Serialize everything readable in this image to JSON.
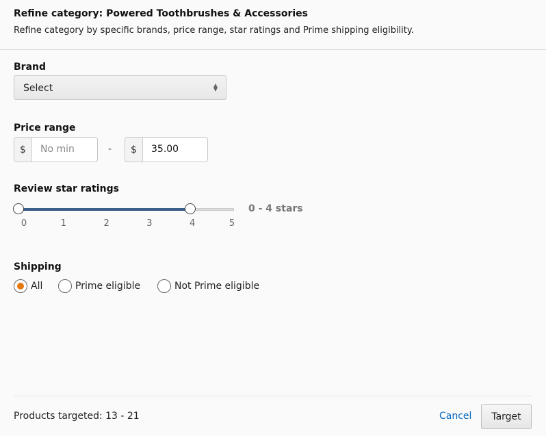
{
  "header": {
    "title": "Refine category: Powered Toothbrushes & Accessories",
    "subtitle": "Refine category by specific brands, price range, star ratings and Prime shipping eligibility."
  },
  "brand": {
    "label": "Brand",
    "selected": "Select"
  },
  "price": {
    "label": "Price range",
    "currency": "$",
    "min_placeholder": "No min",
    "max_value": "35.00",
    "separator": "-"
  },
  "rating": {
    "label": "Review star ratings",
    "min": 0,
    "max": 5,
    "selected_min": 0,
    "selected_max": 4,
    "ticks": [
      "0",
      "1",
      "2",
      "3",
      "4",
      "5"
    ],
    "range_text": "0 - 4 stars",
    "fill_color": "#3b5f88"
  },
  "shipping": {
    "label": "Shipping",
    "options": [
      "All",
      "Prime eligible",
      "Not Prime eligible"
    ],
    "selected": "All",
    "accent": "#e47911"
  },
  "footer": {
    "products_targeted": "Products targeted: 13 - 21",
    "cancel": "Cancel",
    "target": "Target"
  }
}
